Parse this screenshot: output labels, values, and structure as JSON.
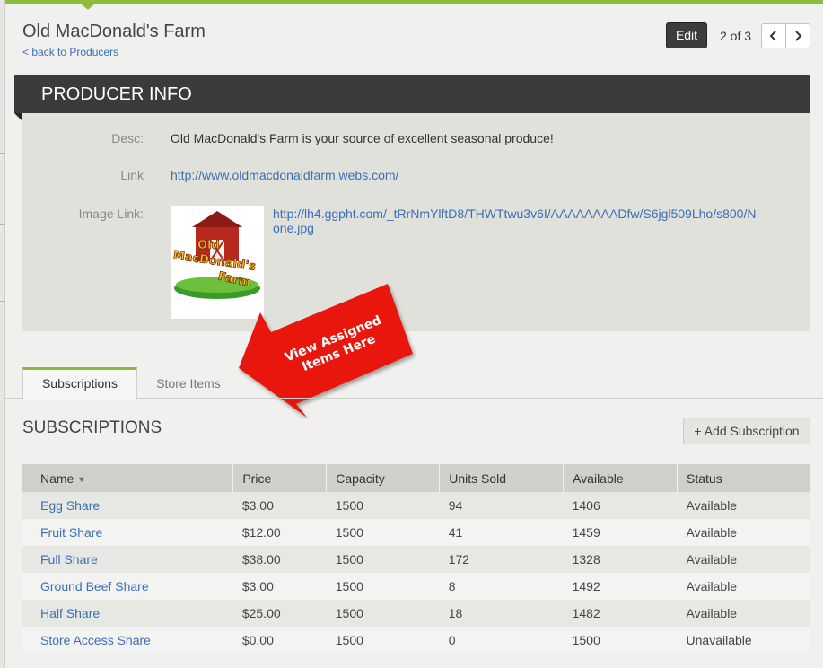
{
  "header": {
    "title": "Old MacDonald's Farm",
    "back_link": "< back to Producers",
    "edit_label": "Edit",
    "pager_text": "2 of 3",
    "prev_icon": "chevron-left-icon",
    "next_icon": "chevron-right-icon"
  },
  "producer_info": {
    "heading": "PRODUCER INFO",
    "desc_label": "Desc:",
    "desc_value": "Old MacDonald's Farm is your source of excellent seasonal produce!",
    "link_label": "Link",
    "link_value": "http://www.oldmacdonaldfarm.webs.com/",
    "image_link_label": "Image Link:",
    "image_link_line1": "http://lh4.ggpht.com/_tRrNmYlftD8/THWTtwu3v6I/AAAAAAAADfw/S6jgl509Lho/s800/N",
    "image_link_line2": "one.jpg",
    "logo_text_line1": "Old",
    "logo_text_line2": "MacDonald's",
    "logo_text_line3": "Farm"
  },
  "callout": {
    "line1": "View Assigned",
    "line2": "Items Here",
    "color": "#e8120c"
  },
  "tabs": [
    {
      "label": "Subscriptions",
      "active": true
    },
    {
      "label": "Store Items",
      "active": false
    }
  ],
  "subscriptions": {
    "title": "SUBSCRIPTIONS",
    "add_button": "+ Add Subscription",
    "columns": [
      "Name",
      "Price",
      "Capacity",
      "Units Sold",
      "Available",
      "Status"
    ],
    "sort_icon": "caret-down-icon",
    "rows": [
      {
        "name": "Egg Share",
        "price": "$3.00",
        "capacity": "1500",
        "units_sold": "94",
        "available": "1406",
        "status": "Available"
      },
      {
        "name": "Fruit Share",
        "price": "$12.00",
        "capacity": "1500",
        "units_sold": "41",
        "available": "1459",
        "status": "Available"
      },
      {
        "name": "Full Share",
        "price": "$38.00",
        "capacity": "1500",
        "units_sold": "172",
        "available": "1328",
        "status": "Available"
      },
      {
        "name": "Ground Beef Share",
        "price": "$3.00",
        "capacity": "1500",
        "units_sold": "8",
        "available": "1492",
        "status": "Available"
      },
      {
        "name": "Half Share",
        "price": "$25.00",
        "capacity": "1500",
        "units_sold": "18",
        "available": "1482",
        "status": "Available"
      },
      {
        "name": "Store Access Share",
        "price": "$0.00",
        "capacity": "1500",
        "units_sold": "0",
        "available": "1500",
        "status": "Unavailable"
      }
    ]
  },
  "colors": {
    "accent": "#8dbb3c",
    "link": "#3a6fb5",
    "banner": "#3b3b3b"
  }
}
